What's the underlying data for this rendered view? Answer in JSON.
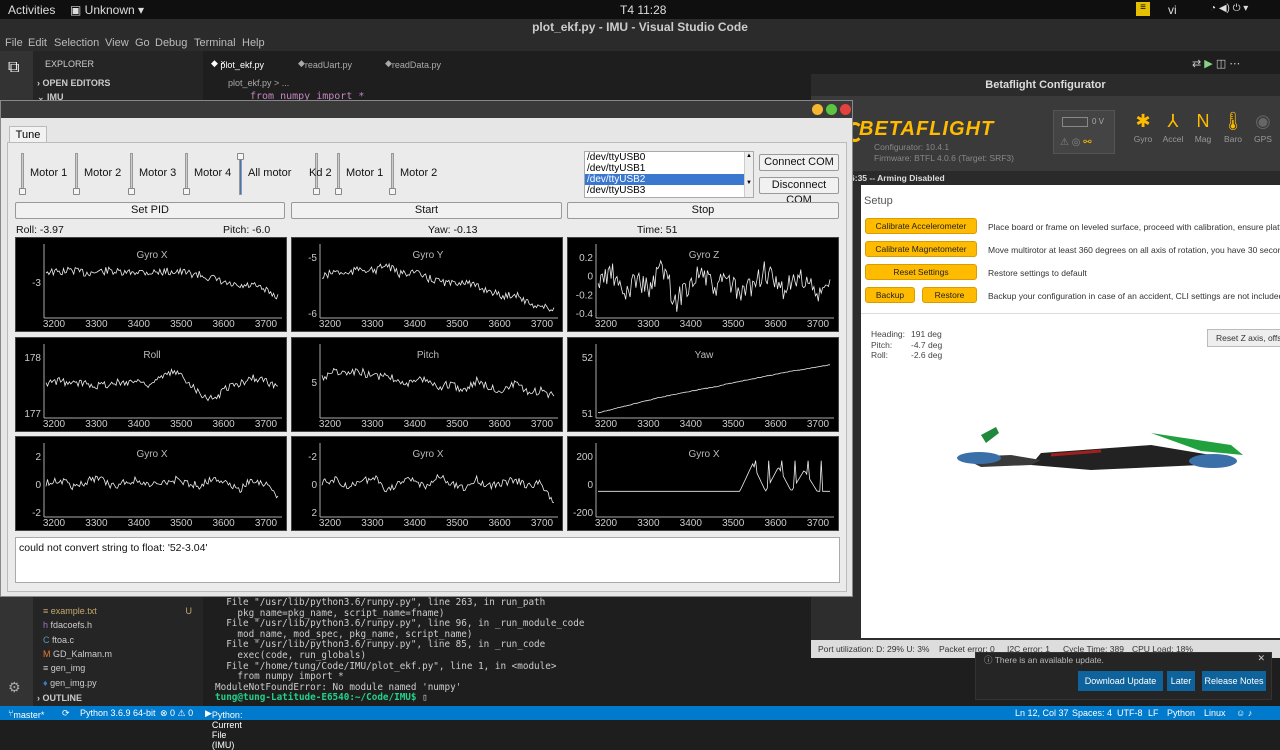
{
  "topbar": {
    "activities": "Activities",
    "app_menu": "Unknown",
    "clock": "T4 11:28",
    "lang": "vi"
  },
  "vscode": {
    "title": "plot_ekf.py - IMU - Visual Studio Code",
    "menu": [
      "File",
      "Edit",
      "Selection",
      "View",
      "Go",
      "Debug",
      "Terminal",
      "Help"
    ],
    "explorer": "EXPLORER",
    "open_editors": "OPEN EDITORS",
    "folder": "IMU",
    "tabs": [
      "plot_ekf.py",
      "readUart.py",
      "readData.py"
    ],
    "breadcrumb": "plot_ekf.py > ...",
    "code_line": "from numpy import *",
    "files": [
      {
        "name": "example.txt",
        "badge": "U"
      },
      {
        "name": "fdacoefs.h"
      },
      {
        "name": "ftoa.c"
      },
      {
        "name": "GD_Kalman.m"
      },
      {
        "name": "gen_img"
      },
      {
        "name": "gen_img.py"
      }
    ],
    "outline": "OUTLINE",
    "terminal": [
      "  File \"/usr/lib/python3.6/runpy.py\", line 263, in run_path",
      "    pkg_name=pkg_name, script_name=fname)",
      "  File \"/usr/lib/python3.6/runpy.py\", line 96, in _run_module_code",
      "    mod_name, mod_spec, pkg_name, script_name)",
      "  File \"/usr/lib/python3.6/runpy.py\", line 85, in _run_code",
      "    exec(code, run_globals)",
      "  File \"/home/tung/Code/IMU/plot_ekf.py\", line 1, in <module>",
      "    from numpy import *",
      "ModuleNotFoundError: No module named 'numpy'"
    ],
    "prompt": "tung@tung-Latitude-E6540:~/Code/IMU$",
    "status": {
      "branch": "master*",
      "python": "Python 3.6.9 64-bit",
      "problems": "⊗ 0 ⚠ 0",
      "run": "Python: Current File (IMU)",
      "pos": "Ln 12, Col 37",
      "spaces": "Spaces: 4",
      "enc": "UTF-8",
      "eol": "LF",
      "lang": "Python",
      "os": "Linux"
    }
  },
  "betaflight": {
    "title": "Betaflight Configurator",
    "logo": "BETAFLIGHT",
    "configurator": "Configurator: 10.4.1",
    "firmware": "Firmware: BTFL 4.0.6 (Target: SRF3)",
    "voltage": "0 V",
    "sensors": [
      "Gyro",
      "Accel",
      "Mag",
      "Baro",
      "GPS"
    ],
    "status_line": "26 @ 11:26:35 -- Arming Disabled",
    "setup": "Setup",
    "actions": [
      {
        "btn": "Calibrate Accelerometer",
        "desc": "Place board or frame on leveled surface, proceed with calibration, ensure platf"
      },
      {
        "btn": "Calibrate Magnetometer",
        "desc": "Move multirotor at least 360 degrees on all axis of rotation, you have 30 second"
      },
      {
        "btn": "Reset Settings",
        "desc": "Restore settings to default"
      },
      {
        "btn": "Backup",
        "btn2": "Restore",
        "desc": "Backup your configuration in case of an accident, CLI settings are not included"
      }
    ],
    "attitude": {
      "heading_l": "Heading:",
      "heading": "191 deg",
      "pitch_l": "Pitch:",
      "pitch": "-4.7 deg",
      "roll_l": "Roll:",
      "roll": "-2.6 deg"
    },
    "reset_z": "Reset Z axis, offs",
    "footer": {
      "port": "Port utilization: D: 29% U: 3%",
      "packet": "Packet error: 0",
      "i2c": "I2C error: 1",
      "cycle": "Cycle Time: 389",
      "cpu": "CPU Load: 18%"
    },
    "notice": "There is an available update.",
    "notice_buttons": [
      "Download Update",
      "Later",
      "Release Notes"
    ]
  },
  "tuner": {
    "tab": "Tune",
    "sliders": [
      {
        "label": "Motor 1",
        "level": 0
      },
      {
        "label": "Motor 2",
        "level": 0
      },
      {
        "label": "Motor 3",
        "level": 0
      },
      {
        "label": "Motor 4",
        "level": 0
      },
      {
        "label": "All motor",
        "level": 1
      },
      {
        "label": "Kd 2",
        "level": 0
      },
      {
        "label": "Motor 1",
        "level": 0
      },
      {
        "label": "Motor 2",
        "level": 0
      }
    ],
    "ports": [
      "/dev/ttyUSB0",
      "/dev/ttyUSB1",
      "/dev/ttyUSB2",
      "/dev/ttyUSB3"
    ],
    "selected_port": "/dev/ttyUSB2",
    "connect": "Connect COM",
    "disconnect": "Disconnect COM",
    "set_pid": "Set PID",
    "start": "Start",
    "stop": "Stop",
    "roll": "Roll: -3.97",
    "pitch": "Pitch: -6.0",
    "yaw": "Yaw: -0.13",
    "time": "Time: 51",
    "log": "could not convert string to float: '52-3.04'"
  },
  "chart_data": [
    {
      "type": "line",
      "title": "Gyro X",
      "xticks": [
        "3200",
        "3300",
        "3400",
        "3500",
        "3600",
        "3700"
      ],
      "yticks": [
        "-3"
      ],
      "series": [
        {
          "values": [
            0.3,
            0.32,
            0.28,
            0.33,
            0.31,
            0.29,
            0.34,
            0.3,
            0.32,
            0.31,
            0.3,
            0.33,
            0.36,
            0.42,
            0.5,
            0.55,
            0.52,
            0.6,
            0.7
          ]
        }
      ]
    },
    {
      "type": "line",
      "title": "Gyro Y",
      "xticks": [
        "3200",
        "3300",
        "3400",
        "3500",
        "3600",
        "3700"
      ],
      "yticks": [
        "-5",
        "-6"
      ],
      "series": [
        {
          "values": [
            0.4,
            0.3,
            0.35,
            0.25,
            0.3,
            0.2,
            0.35,
            0.3,
            0.4,
            0.45,
            0.5,
            0.45,
            0.55,
            0.6,
            0.7,
            0.65,
            0.8,
            0.85,
            0.9
          ]
        }
      ]
    },
    {
      "type": "line",
      "title": "Gyro Z",
      "xticks": [
        "3200",
        "3300",
        "3400",
        "3500",
        "3600",
        "3700"
      ],
      "yticks": [
        "0.2",
        "0",
        "-0.2",
        "-0.4"
      ],
      "series": [
        {
          "values": [
            0.5,
            0.3,
            0.7,
            0.4,
            0.6,
            0.2,
            0.8,
            0.5,
            0.3,
            0.6,
            0.4,
            0.7,
            0.5,
            0.3,
            0.6,
            0.5,
            0.4,
            0.7,
            0.5
          ]
        }
      ]
    },
    {
      "type": "line",
      "title": "Roll",
      "xticks": [
        "3200",
        "3300",
        "3400",
        "3500",
        "3600",
        "3700"
      ],
      "yticks": [
        "178",
        "177"
      ],
      "series": [
        {
          "values": [
            0.5,
            0.45,
            0.5,
            0.48,
            0.52,
            0.5,
            0.47,
            0.45,
            0.5,
            0.4,
            0.3,
            0.45,
            0.65,
            0.75,
            0.55,
            0.5,
            0.4,
            0.45,
            0.55
          ]
        }
      ]
    },
    {
      "type": "line",
      "title": "Pitch",
      "xticks": [
        "3200",
        "3300",
        "3400",
        "3500",
        "3600",
        "3700"
      ],
      "yticks": [
        "5"
      ],
      "series": [
        {
          "values": [
            0.4,
            0.3,
            0.35,
            0.3,
            0.4,
            0.35,
            0.45,
            0.5,
            0.4,
            0.55,
            0.5,
            0.6,
            0.45,
            0.55,
            0.6,
            0.5,
            0.65,
            0.6,
            0.7
          ]
        }
      ]
    },
    {
      "type": "line",
      "title": "Yaw",
      "xticks": [
        "3200",
        "3300",
        "3400",
        "3500",
        "3600",
        "3700"
      ],
      "yticks": [
        "52",
        "51"
      ],
      "series": [
        {
          "values": [
            0.95,
            0.9,
            0.85,
            0.8,
            0.75,
            0.7,
            0.66,
            0.62,
            0.58,
            0.55,
            0.5,
            0.46,
            0.42,
            0.38,
            0.34,
            0.3,
            0.27,
            0.23,
            0.2
          ]
        }
      ]
    },
    {
      "type": "line",
      "title": "Gyro X",
      "xticks": [
        "3200",
        "3300",
        "3400",
        "3500",
        "3600",
        "3700"
      ],
      "yticks": [
        "2",
        "0",
        "-2"
      ],
      "series": [
        {
          "values": [
            0.5,
            0.45,
            0.55,
            0.5,
            0.4,
            0.55,
            0.5,
            0.45,
            0.55,
            0.5,
            0.45,
            0.5,
            0.55,
            0.4,
            0.5,
            0.6,
            0.45,
            0.5,
            0.7
          ]
        }
      ]
    },
    {
      "type": "line",
      "title": "Gyro X",
      "xticks": [
        "3200",
        "3300",
        "3400",
        "3500",
        "3600",
        "3700"
      ],
      "yticks": [
        "-2",
        "0",
        "2"
      ],
      "series": [
        {
          "values": [
            0.5,
            0.45,
            0.55,
            0.5,
            0.4,
            0.6,
            0.5,
            0.45,
            0.55,
            0.4,
            0.5,
            0.6,
            0.45,
            0.55,
            0.5,
            0.45,
            0.55,
            0.5,
            0.8
          ]
        }
      ]
    },
    {
      "type": "line",
      "title": "Gyro X",
      "xticks": [
        "3200",
        "3300",
        "3400",
        "3500",
        "3600",
        "3700"
      ],
      "yticks": [
        "200",
        "0",
        "-200"
      ],
      "series": [
        {
          "values": [
            0.63,
            0.63,
            0.63,
            0.63,
            0.63,
            0.63,
            0.63,
            0.63,
            0.63,
            0.63,
            0.63,
            0.63,
            0.2,
            0.63,
            0.25,
            0.63,
            0.3,
            0.63,
            0.63
          ]
        }
      ]
    }
  ],
  "colors": {
    "accent": "#ffbb00",
    "vscode_blue": "#007acc",
    "selection": "#3a78d0"
  }
}
